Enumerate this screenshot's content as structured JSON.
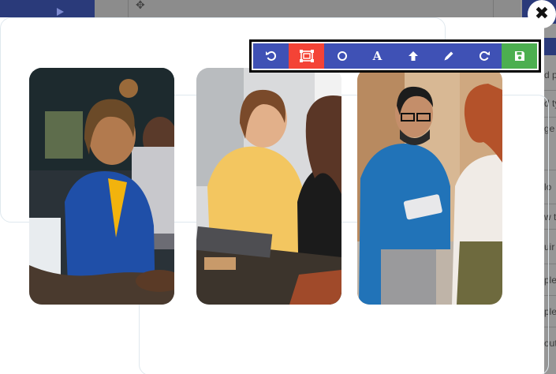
{
  "background_app": {
    "right_panel_fragments": [
      "d p",
      "d ty",
      "ge",
      "lo",
      "w t",
      "uir",
      "ple",
      "ple",
      "out"
    ]
  },
  "dialog": {
    "close_glyph": "✖",
    "toolbar": {
      "buttons": [
        {
          "name": "undo",
          "icon": "undo-icon",
          "active": false
        },
        {
          "name": "crop",
          "icon": "crop-select-icon",
          "active": true
        },
        {
          "name": "circle",
          "icon": "circle-icon",
          "active": false
        },
        {
          "name": "text",
          "icon": "text-icon",
          "label": "A",
          "active": false
        },
        {
          "name": "arrow",
          "icon": "arrow-up-icon",
          "active": false
        },
        {
          "name": "pencil",
          "icon": "pencil-icon",
          "active": false
        },
        {
          "name": "redo",
          "icon": "redo-icon",
          "active": false
        },
        {
          "name": "save",
          "icon": "floppy-disk-icon",
          "active": false
        }
      ],
      "colors": {
        "primary": "#3f51b5",
        "active": "#f44336",
        "save": "#4caf50"
      }
    },
    "photos": [
      {
        "subject": "smiling woman in blue blazer with colleagues at a desk"
      },
      {
        "subject": "two women collaborating at a laptop"
      },
      {
        "subject": "man in blue sweater writing on a tablet beside a woman"
      }
    ]
  }
}
